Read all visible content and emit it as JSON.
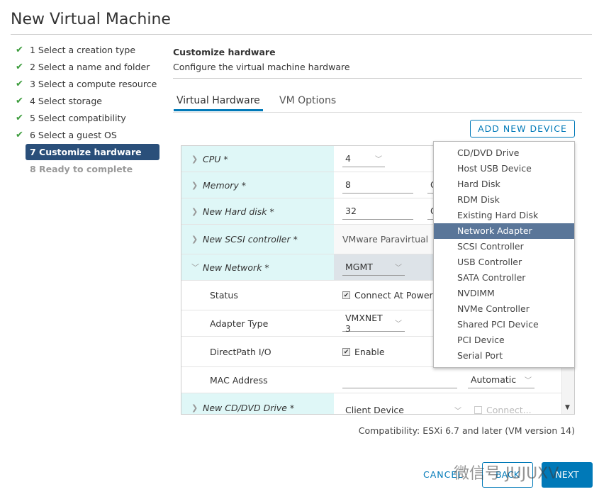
{
  "window": {
    "title": "New Virtual Machine"
  },
  "steps": [
    {
      "label": "1 Select a creation type",
      "status": "done"
    },
    {
      "label": "2 Select a name and folder",
      "status": "done"
    },
    {
      "label": "3 Select a compute resource",
      "status": "done"
    },
    {
      "label": "4 Select storage",
      "status": "done"
    },
    {
      "label": "5 Select compatibility",
      "status": "done"
    },
    {
      "label": "6 Select a guest OS",
      "status": "done"
    },
    {
      "label": "7 Customize hardware",
      "status": "active"
    },
    {
      "label": "8 Ready to complete",
      "status": "pending"
    }
  ],
  "main": {
    "heading": "Customize hardware",
    "subheading": "Configure the virtual machine hardware",
    "tabs": [
      {
        "label": "Virtual Hardware",
        "active": true
      },
      {
        "label": "VM Options",
        "active": false
      }
    ],
    "add_device_label": "ADD NEW DEVICE"
  },
  "hardware": {
    "cpu": {
      "label": "CPU *",
      "value": "4"
    },
    "memory": {
      "label": "Memory *",
      "value": "8",
      "unit": "G"
    },
    "disk": {
      "label": "New Hard disk *",
      "value": "32",
      "unit": "G"
    },
    "scsi": {
      "label": "New SCSI controller *",
      "value": "VMware Paravirtual"
    },
    "network": {
      "label": "New Network *",
      "value": "MGMT"
    },
    "status": {
      "label": "Status",
      "value": "Connect At Power",
      "checked": true
    },
    "adapter": {
      "label": "Adapter Type",
      "value": "VMXNET 3"
    },
    "directpath": {
      "label": "DirectPath I/O",
      "value": "Enable",
      "checked": true
    },
    "mac": {
      "label": "MAC Address",
      "value": "",
      "mode": "Automatic"
    },
    "cdrom": {
      "label": "New CD/DVD Drive *",
      "value": "Client Device",
      "connect": "Connect...",
      "checked": false
    }
  },
  "menu": {
    "items": [
      "CD/DVD Drive",
      "Host USB Device",
      "Hard Disk",
      "RDM Disk",
      "Existing Hard Disk",
      "Network Adapter",
      "SCSI Controller",
      "USB Controller",
      "SATA Controller",
      "NVDIMM",
      "NVMe Controller",
      "Shared PCI Device",
      "PCI Device",
      "Serial Port"
    ],
    "highlighted": "Network Adapter"
  },
  "footer": {
    "compat": "Compatibility: ESXi 6.7 and later (VM version 14)",
    "cancel": "CANCEL",
    "back": "BACK",
    "next": "NEXT"
  },
  "watermark": "微信号 JUJUXV",
  "colors": {
    "accent": "#0079b8",
    "active_step": "#2a4f7a",
    "check": "#3c9c3c",
    "row_label_bg": "#dff7f7",
    "menu_highlight": "#5a7699"
  }
}
